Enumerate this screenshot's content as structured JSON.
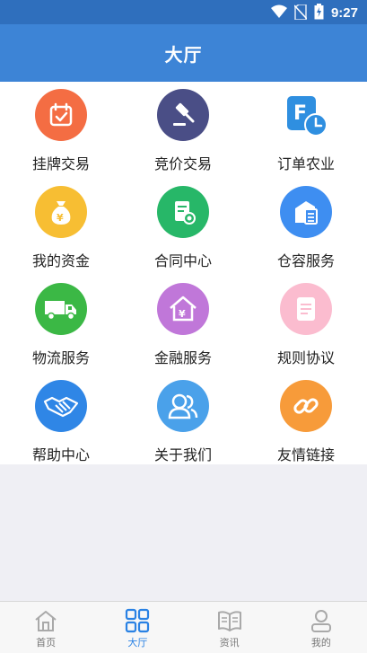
{
  "status_bar": {
    "time": "9:27",
    "icons": [
      "wifi-icon",
      "no-sim-icon",
      "battery-charging-icon"
    ]
  },
  "header": {
    "title": "大厅"
  },
  "grid": {
    "items": [
      {
        "label": "挂牌交易",
        "icon": "calendar-check-icon",
        "color": "#f46d43"
      },
      {
        "label": "竞价交易",
        "icon": "auction-gavel-icon",
        "color": "#4a4e86"
      },
      {
        "label": "订单农业",
        "icon": "order-clock-icon",
        "color": "#2f8fe0"
      },
      {
        "label": "我的资金",
        "icon": "money-bag-icon",
        "color": "#f7be33"
      },
      {
        "label": "合同中心",
        "icon": "contract-document-icon",
        "color": "#27b768"
      },
      {
        "label": "仓容服务",
        "icon": "warehouse-icon",
        "color": "#3e8ef1"
      },
      {
        "label": "物流服务",
        "icon": "truck-icon",
        "color": "#3bb845"
      },
      {
        "label": "金融服务",
        "icon": "finance-house-icon",
        "color": "#c077d9"
      },
      {
        "label": "规则协议",
        "icon": "rules-document-icon",
        "color": "#fbbccf"
      },
      {
        "label": "帮助中心",
        "icon": "handshake-icon",
        "color": "#2f86e6"
      },
      {
        "label": "关于我们",
        "icon": "users-icon",
        "color": "#4aa1ea"
      },
      {
        "label": "友情链接",
        "icon": "link-icon",
        "color": "#f79b3a"
      }
    ]
  },
  "tabbar": {
    "active": "大厅",
    "accent": "#2a82e4",
    "tabs": [
      {
        "label": "首页",
        "icon": "home-icon"
      },
      {
        "label": "大厅",
        "icon": "grid-icon"
      },
      {
        "label": "资讯",
        "icon": "news-icon"
      },
      {
        "label": "我的",
        "icon": "profile-icon"
      }
    ]
  }
}
